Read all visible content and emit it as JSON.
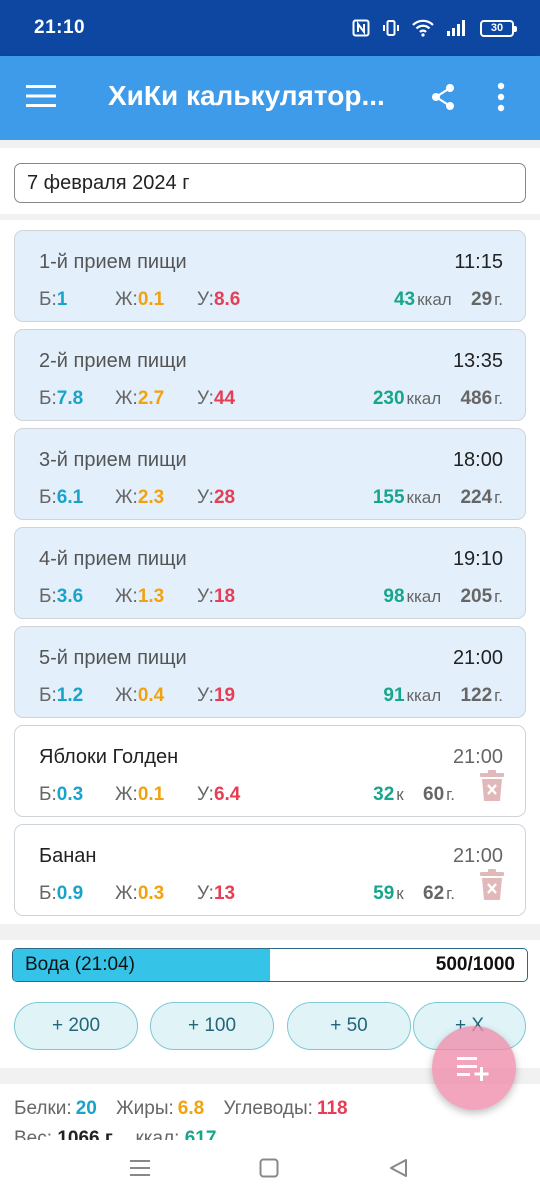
{
  "status": {
    "time": "21:10",
    "battery": "30"
  },
  "app": {
    "title": "ХиКи калькулятор..."
  },
  "date": {
    "value": "7 февраля 2024 г"
  },
  "labels": {
    "protein": "Б:",
    "fat": "Ж:",
    "carbs": "У:",
    "kcal": "ккал",
    "kcal_short": "к",
    "grams": "г."
  },
  "meals": [
    {
      "title": "1-й прием пищи",
      "time": "11:15",
      "protein": "1",
      "fat": "0.1",
      "carbs": "8.6",
      "kcal": "43",
      "weight": "29"
    },
    {
      "title": "2-й прием пищи",
      "time": "13:35",
      "protein": "7.8",
      "fat": "2.7",
      "carbs": "44",
      "kcal": "230",
      "weight": "486"
    },
    {
      "title": "3-й прием пищи",
      "time": "18:00",
      "protein": "6.1",
      "fat": "2.3",
      "carbs": "28",
      "kcal": "155",
      "weight": "224"
    },
    {
      "title": "4-й прием пищи",
      "time": "19:10",
      "protein": "3.6",
      "fat": "1.3",
      "carbs": "18",
      "kcal": "98",
      "weight": "205"
    },
    {
      "title": "5-й прием пищи",
      "time": "21:00",
      "protein": "1.2",
      "fat": "0.4",
      "carbs": "19",
      "kcal": "91",
      "weight": "122"
    }
  ],
  "foods": [
    {
      "title": "Яблоки Голден",
      "time": "21:00",
      "protein": "0.3",
      "fat": "0.1",
      "carbs": "6.4",
      "kcal": "32",
      "weight": "60"
    },
    {
      "title": "Банан",
      "time": "21:00",
      "protein": "0.9",
      "fat": "0.3",
      "carbs": "13",
      "kcal": "59",
      "weight": "62"
    }
  ],
  "water": {
    "label": "Вода (21:04)",
    "amount": "500/1000",
    "fraction": 0.5
  },
  "water_buttons": [
    "+ 200",
    "+ 100",
    "+ 50",
    "+ X"
  ],
  "totals": {
    "protein_label": "Белки:",
    "protein": "20",
    "fat_label": "Жиры:",
    "fat": "6.8",
    "carbs_label": "Углеводы:",
    "carbs": "118",
    "weight_label": "Вес:",
    "weight": "1066 г.",
    "kcal_label": "ккал:",
    "kcal": "617"
  },
  "colors": {
    "status_bar": "#0d47a1",
    "app_bar": "#3d9be9",
    "protein": "#1aa3c9",
    "fat": "#f2a20f",
    "carbs": "#e53e55",
    "kcal": "#17a58b",
    "water": "#36c3e8",
    "fab": "#f08caa"
  }
}
